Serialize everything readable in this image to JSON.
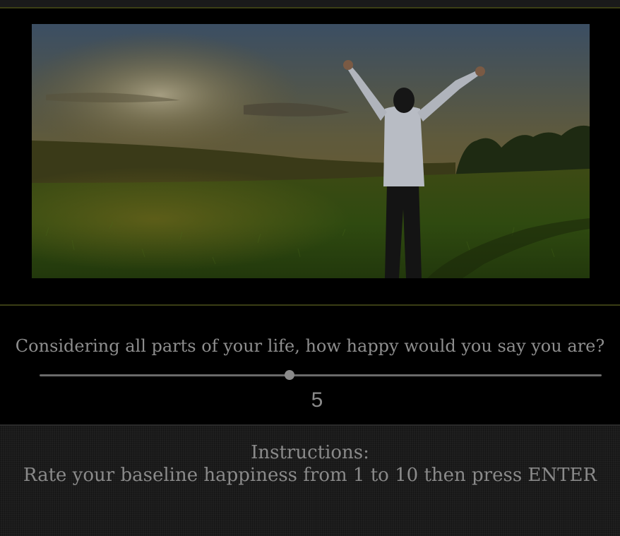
{
  "hero": {
    "image_description_icon": "person-arms-raised-sunset-field"
  },
  "survey": {
    "question": "Considering all parts of your life, how happy would you say you are?",
    "slider": {
      "min": 1,
      "max": 10,
      "value": 5
    },
    "value_label": "5"
  },
  "instructions": {
    "title": "Instructions:",
    "text": "Rate your baseline happiness from 1 to 10 then press ENTER"
  },
  "colors": {
    "background": "#000000",
    "text": "#8e8e8e",
    "divider": "#3a3d15"
  }
}
